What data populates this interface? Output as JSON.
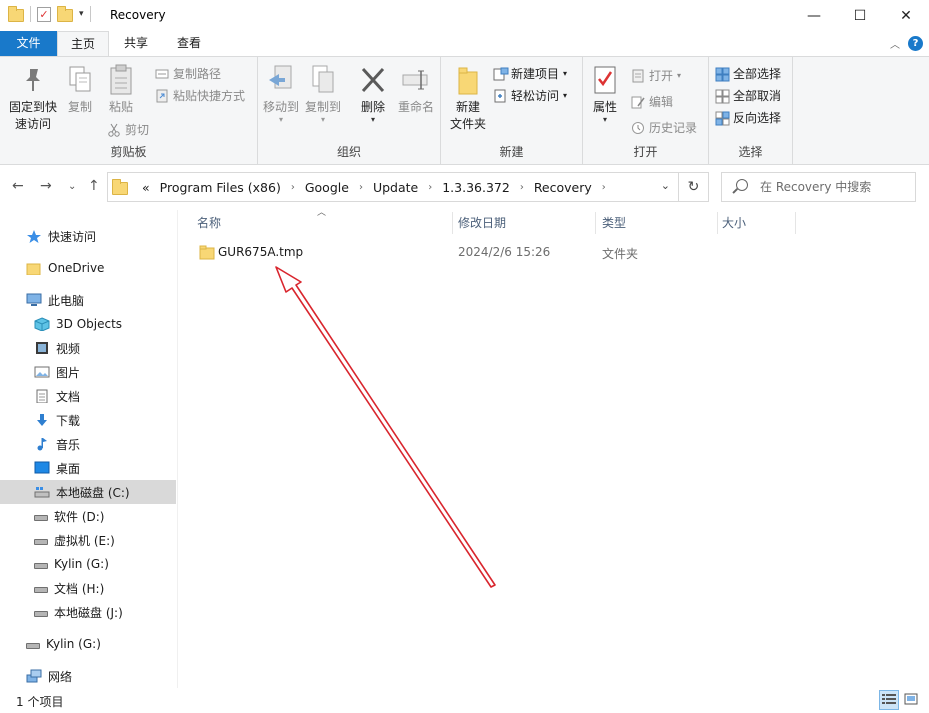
{
  "window": {
    "title": "Recovery",
    "minimize_glyph": "—",
    "maximize_glyph": "☐",
    "close_glyph": "✕"
  },
  "ribbon_tabs": {
    "file": "文件",
    "home": "主页",
    "share": "共享",
    "view": "查看"
  },
  "ribbon": {
    "clipboard": {
      "label": "剪贴板",
      "pin": "固定到快\n速访问",
      "pin_l1": "固定到快",
      "pin_l2": "速访问",
      "copy": "复制",
      "paste": "粘贴",
      "copy_path": "复制路径",
      "paste_shortcut": "粘贴快捷方式",
      "cut": "剪切"
    },
    "organize": {
      "label": "组织",
      "move_to": "移动到",
      "copy_to": "复制到",
      "delete": "删除",
      "rename": "重命名"
    },
    "new": {
      "label": "新建",
      "new_folder_l1": "新建",
      "new_folder_l2": "文件夹",
      "new_item": "新建项目",
      "easy_access": "轻松访问"
    },
    "open": {
      "label": "打开",
      "properties": "属性",
      "open": "打开",
      "edit": "编辑",
      "history": "历史记录"
    },
    "select": {
      "label": "选择",
      "select_all": "全部选择",
      "select_none": "全部取消",
      "invert": "反向选择"
    }
  },
  "address": {
    "prefix": "«",
    "crumbs": [
      "Program Files (x86)",
      "Google",
      "Update",
      "1.3.36.372",
      "Recovery"
    ],
    "separator": "›"
  },
  "search": {
    "placeholder": "在 Recovery 中搜索"
  },
  "sidebar": {
    "quick_access": "快速访问",
    "onedrive": "OneDrive",
    "this_pc": "此电脑",
    "items": [
      {
        "label": "3D Objects",
        "icon": "3d-objects-icon"
      },
      {
        "label": "视频",
        "icon": "video-icon"
      },
      {
        "label": "图片",
        "icon": "pictures-icon"
      },
      {
        "label": "文档",
        "icon": "documents-icon"
      },
      {
        "label": "下载",
        "icon": "download-icon"
      },
      {
        "label": "音乐",
        "icon": "music-icon"
      },
      {
        "label": "桌面",
        "icon": "desktop-icon"
      },
      {
        "label": "本地磁盘 (C:)",
        "icon": "drive-icon"
      },
      {
        "label": "软件 (D:)",
        "icon": "drive-icon"
      },
      {
        "label": "虚拟机 (E:)",
        "icon": "drive-icon"
      },
      {
        "label": "Kylin (G:)",
        "icon": "drive-icon"
      },
      {
        "label": "文档 (H:)",
        "icon": "drive-icon"
      },
      {
        "label": "本地磁盘 (J:)",
        "icon": "drive-icon"
      }
    ],
    "kylin": "Kylin (G:)",
    "network": "网络"
  },
  "columns": {
    "name": "名称",
    "modified": "修改日期",
    "type": "类型",
    "size": "大小"
  },
  "files": [
    {
      "name": "GUR675A.tmp",
      "modified": "2024/2/6 15:26",
      "type": "文件夹",
      "size": ""
    }
  ],
  "status": {
    "count": "1 个项目"
  },
  "colors": {
    "accent": "#1979ca",
    "folder": "#f8d775",
    "annotation": "#d9262e",
    "selected_bg": "#d9d9d9"
  }
}
